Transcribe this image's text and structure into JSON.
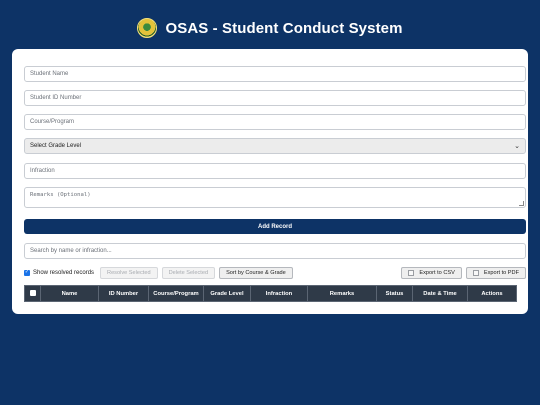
{
  "header": {
    "title": "OSAS - Student Conduct System",
    "logo_icon": "university-seal-icon"
  },
  "form": {
    "student_name_placeholder": "Student Name",
    "student_id_placeholder": "Student ID Number",
    "course_placeholder": "Course/Program",
    "grade_level_selected": "Select Grade Level",
    "infraction_placeholder": "Infraction",
    "remarks_placeholder": "Remarks (Optional)",
    "add_button": "Add Record"
  },
  "search": {
    "placeholder": "Search by name or infraction..."
  },
  "toolbar": {
    "show_resolved_label": "Show resolved records",
    "show_resolved_checked": true,
    "resolve_selected": "Resolve Selected",
    "delete_selected": "Delete Selected",
    "sort_button": "Sort by Course & Grade",
    "export_csv": "Export to CSV",
    "export_pdf": "Export to PDF"
  },
  "table": {
    "columns": [
      "Name",
      "ID Number",
      "Course/Program",
      "Grade Level",
      "Infraction",
      "Remarks",
      "Status",
      "Date & Time",
      "Actions"
    ]
  },
  "colors": {
    "brand": "#0d3366",
    "table_header": "#2f3a48",
    "card": "#ffffff"
  }
}
